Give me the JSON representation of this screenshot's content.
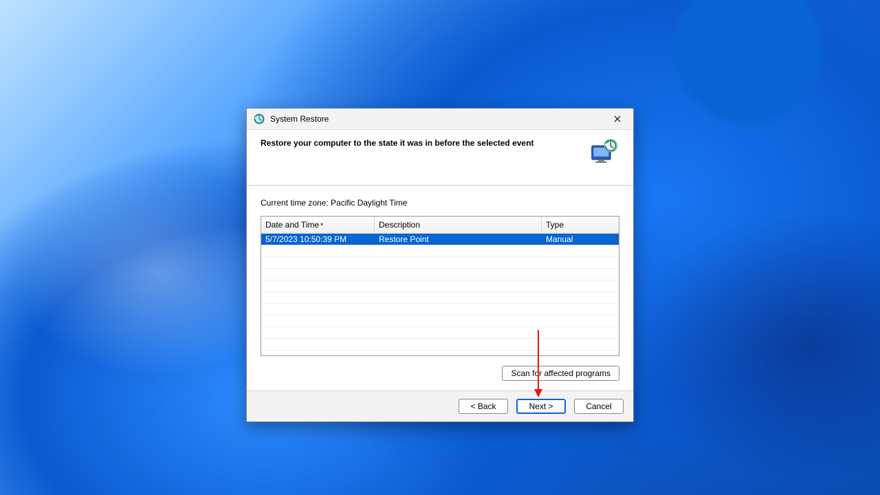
{
  "window": {
    "title": "System Restore"
  },
  "header": {
    "headline": "Restore your computer to the state it was in before the selected event"
  },
  "body": {
    "timezone_label": "Current time zone: Pacific Daylight Time",
    "columns": {
      "date_time": "Date and Time",
      "description": "Description",
      "type": "Type"
    },
    "rows": [
      {
        "date_time": "5/7/2023 10:50:39 PM",
        "description": "Restore Point",
        "type": "Manual",
        "selected": true
      }
    ],
    "scan_button": "Scan for affected programs"
  },
  "footer": {
    "back": "< Back",
    "next": "Next >",
    "cancel": "Cancel"
  }
}
